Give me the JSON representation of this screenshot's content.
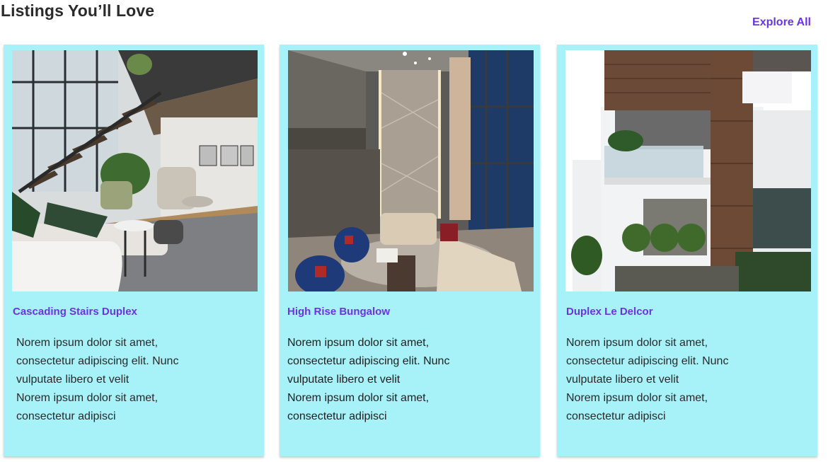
{
  "section": {
    "title": "Listings You’ll Love",
    "explore_label": "Explore All"
  },
  "colors": {
    "card_background": "#a6f2f8",
    "accent": "#6a35e0"
  },
  "listings": [
    {
      "title": "Cascading Stairs Duplex",
      "desc_line1": "Norem ipsum dolor sit amet, consectetur adipiscing elit. Nunc vulputate libero et velit",
      "desc_line2": "Norem ipsum dolor sit amet, consectetur adipisci",
      "image": "living-room-with-staircase-photo"
    },
    {
      "title": "High Rise Bungalow",
      "desc_line1": "Norem ipsum dolor sit amet, consectetur adipiscing elit. Nunc vulputate libero et velit",
      "desc_line2": "Norem ipsum dolor sit amet, consectetur adipisci",
      "image": "tall-lounge-interior-photo"
    },
    {
      "title": "Duplex Le Delcor",
      "desc_line1": "Norem ipsum dolor sit amet, consectetur adipiscing elit. Nunc vulputate libero et velit",
      "desc_line2": "Norem ipsum dolor sit amet, consectetur adipisci",
      "image": "duplex-house-exterior-photo"
    }
  ]
}
